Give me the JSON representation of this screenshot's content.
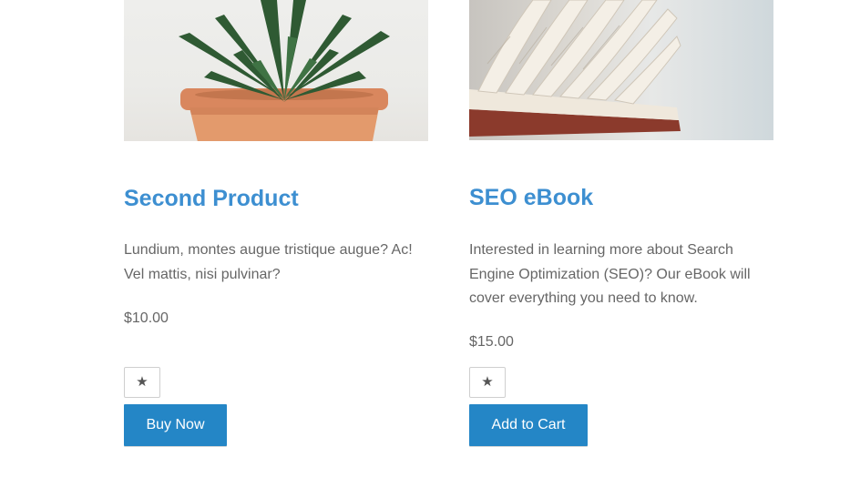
{
  "products": [
    {
      "title": "Second Product",
      "description": "Lundium, montes augue tristique augue? Ac! Vel mattis, nisi pulvinar?",
      "price": "$10.00",
      "wishlist_icon": "★",
      "button_label": "Buy Now",
      "image": "potted-succulent-photo"
    },
    {
      "title": "SEO eBook",
      "description": "Interested in learning more about Search Engine Optimization (SEO)? Our eBook will cover everything you need to know.",
      "price": "$15.00",
      "wishlist_icon": "★",
      "button_label": "Add to Cart",
      "image": "open-book-photo"
    }
  ],
  "colors": {
    "title": "#3d8fd1",
    "button": "#2486c6",
    "text": "#666666"
  }
}
